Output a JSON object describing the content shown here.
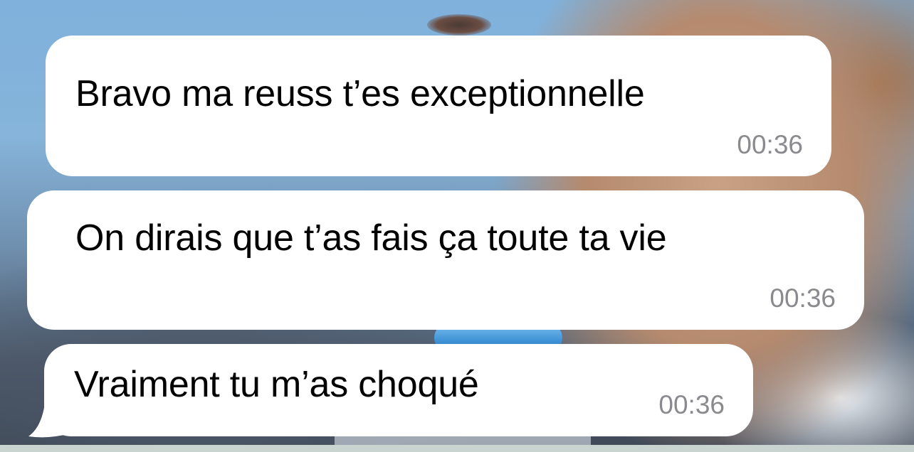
{
  "messages": [
    {
      "text": "Bravo ma reuss t’es exceptionnelle",
      "time": "00:36"
    },
    {
      "text": "On dirais que t’as fais ça toute ta vie",
      "time": "00:36"
    },
    {
      "text": "Vraiment tu m’as choqué",
      "time": "00:36"
    }
  ],
  "colors": {
    "bubble": "#ffffff",
    "message_text": "#000000",
    "timestamp": "#8a8a8e"
  },
  "icons": {
    "bubble_tail": "incoming-bubble-tail-icon"
  }
}
